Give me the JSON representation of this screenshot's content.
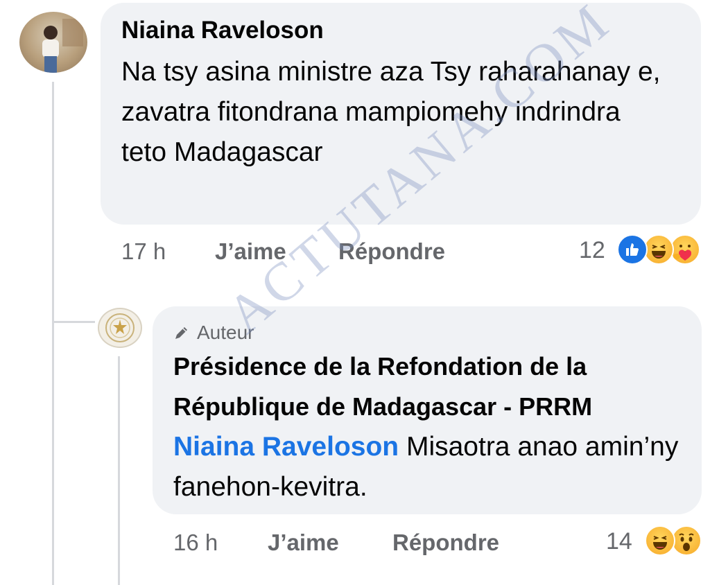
{
  "comment": {
    "author": "Niaina Raveloson",
    "text": "Na tsy asina ministre aza Tsy raharahanay e, zavatra fitondrana mampiomehy indrindra teto Madagascar",
    "time": "17 h",
    "like_label": "J’aime",
    "reply_label": "Répondre",
    "reaction_count": "12",
    "reactions": [
      "like-icon",
      "haha-icon",
      "care-icon"
    ]
  },
  "reply": {
    "badge": "Auteur",
    "author": "Présidence de la Refondation de la République de Madagascar - PRRM",
    "mention": "Niaina Raveloson",
    "text": "Misaotra anao amin’ny fanehon-kevitra.",
    "time": "16 h",
    "like_label": "J’aime",
    "reply_label": "Répondre",
    "reaction_count": "14",
    "reactions": [
      "haha-icon",
      "wow-icon"
    ]
  },
  "watermark": "ACTUTANA.COM",
  "colors": {
    "bubble": "#f0f2f5",
    "mention": "#1b74e4",
    "meta": "#65676b",
    "like": "#1b74e4"
  }
}
